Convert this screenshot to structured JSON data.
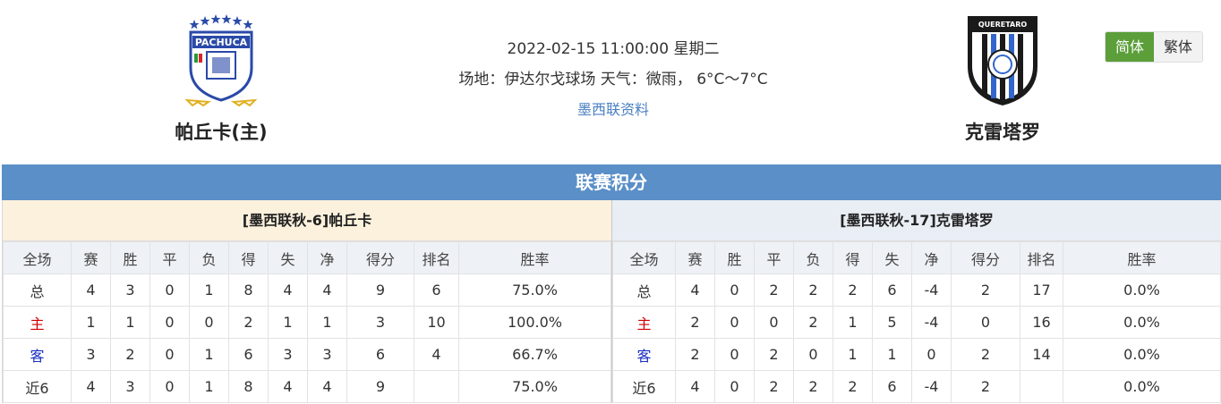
{
  "match": {
    "datetime": "2022-02-15 11:00:00 星期二",
    "venue_line": "场地：伊达尔戈球场 天气：微雨， 6°C～7°C",
    "league_link": "墨西联资料"
  },
  "home_team": {
    "name": "帕丘卡(主)",
    "logo_text": "PACHUCA"
  },
  "away_team": {
    "name": "克雷塔罗",
    "logo_text": "QUERETARO"
  },
  "lang": {
    "simplified": "简体",
    "traditional": "繁体"
  },
  "standings": {
    "title": "联赛积分",
    "columns": [
      "全场",
      "赛",
      "胜",
      "平",
      "负",
      "得",
      "失",
      "净",
      "得分",
      "排名",
      "胜率"
    ],
    "home": {
      "header": "[墨西联秋-6]帕丘卡",
      "rows": [
        [
          "总",
          "4",
          "3",
          "0",
          "1",
          "8",
          "4",
          "4",
          "9",
          "6",
          "75.0%"
        ],
        [
          "主",
          "1",
          "1",
          "0",
          "0",
          "2",
          "1",
          "1",
          "3",
          "10",
          "100.0%"
        ],
        [
          "客",
          "3",
          "2",
          "0",
          "1",
          "6",
          "3",
          "3",
          "6",
          "4",
          "66.7%"
        ],
        [
          "近6",
          "4",
          "3",
          "0",
          "1",
          "8",
          "4",
          "4",
          "9",
          "",
          "75.0%"
        ]
      ]
    },
    "away": {
      "header": "[墨西联秋-17]克雷塔罗",
      "rows": [
        [
          "总",
          "4",
          "0",
          "2",
          "2",
          "2",
          "6",
          "-4",
          "2",
          "17",
          "0.0%"
        ],
        [
          "主",
          "2",
          "0",
          "0",
          "2",
          "1",
          "5",
          "-4",
          "0",
          "16",
          "0.0%"
        ],
        [
          "客",
          "2",
          "0",
          "2",
          "0",
          "1",
          "1",
          "0",
          "2",
          "14",
          "0.0%"
        ],
        [
          "近6",
          "4",
          "0",
          "2",
          "2",
          "2",
          "6",
          "-4",
          "2",
          "",
          "0.0%"
        ]
      ]
    }
  }
}
